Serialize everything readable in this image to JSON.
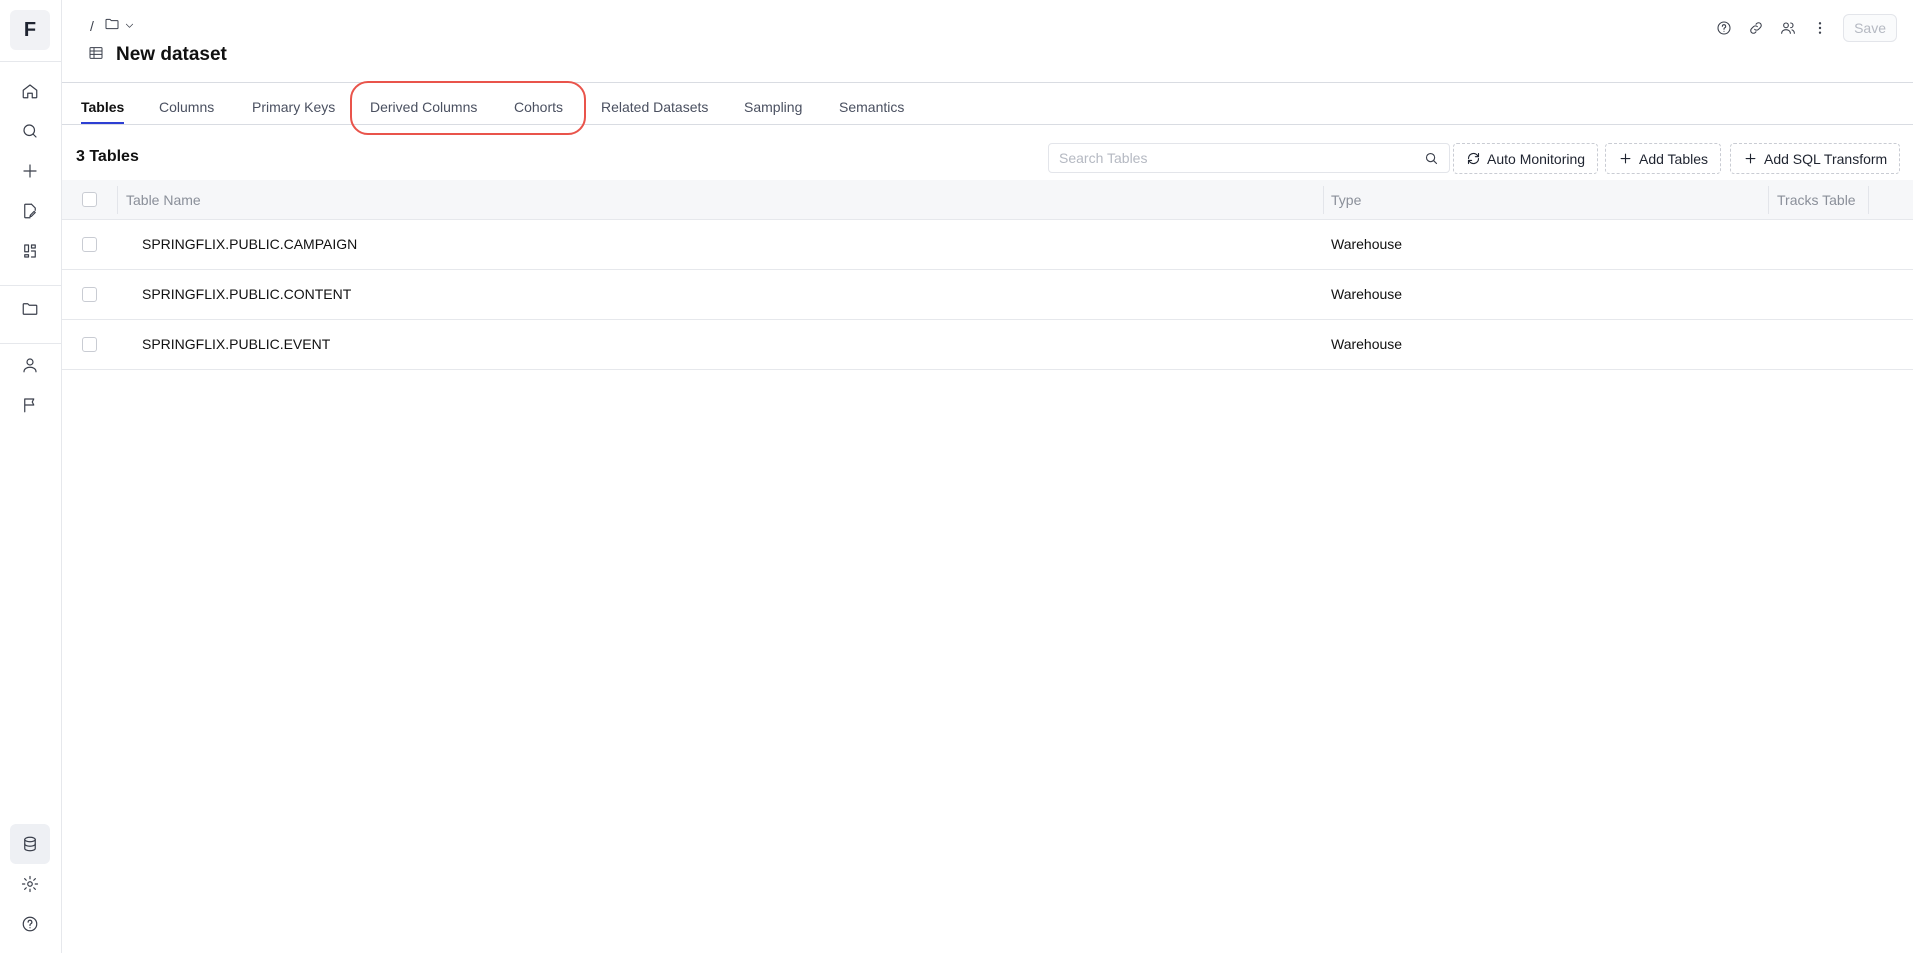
{
  "app": {
    "logo_letter": "F"
  },
  "rail": {
    "top_icons": [
      "home-icon",
      "search-icon",
      "plus-icon",
      "edit-doc-icon",
      "lab-icon",
      "folder-icon",
      "user-icon",
      "flag-icon"
    ],
    "bottom_icons": [
      "database-icon",
      "gear-icon",
      "help-icon"
    ],
    "active": "database-icon"
  },
  "header": {
    "breadcrumb_sep": "/",
    "title": "New dataset",
    "save_label": "Save"
  },
  "tabs": [
    {
      "label": "Tables",
      "active": true
    },
    {
      "label": "Columns",
      "active": false
    },
    {
      "label": "Primary Keys",
      "active": false
    },
    {
      "label": "Derived Columns",
      "active": false
    },
    {
      "label": "Cohorts",
      "active": false
    },
    {
      "label": "Related Datasets",
      "active": false
    },
    {
      "label": "Sampling",
      "active": false
    },
    {
      "label": "Semantics",
      "active": false
    }
  ],
  "toolbar": {
    "count_label": "3 Tables",
    "search_placeholder": "Search Tables",
    "auto_monitoring_label": "Auto Monitoring",
    "add_tables_label": "Add Tables",
    "add_sql_label": "Add SQL Transform"
  },
  "table": {
    "headers": {
      "name": "Table Name",
      "type": "Type",
      "tracks": "Tracks Table"
    },
    "rows": [
      {
        "name": "SPRINGFLIX.PUBLIC.CAMPAIGN",
        "type": "Warehouse"
      },
      {
        "name": "SPRINGFLIX.PUBLIC.CONTENT",
        "type": "Warehouse"
      },
      {
        "name": "SPRINGFLIX.PUBLIC.EVENT",
        "type": "Warehouse"
      }
    ]
  },
  "colors": {
    "accent": "#2d3fd3",
    "highlight": "#e9544b"
  }
}
